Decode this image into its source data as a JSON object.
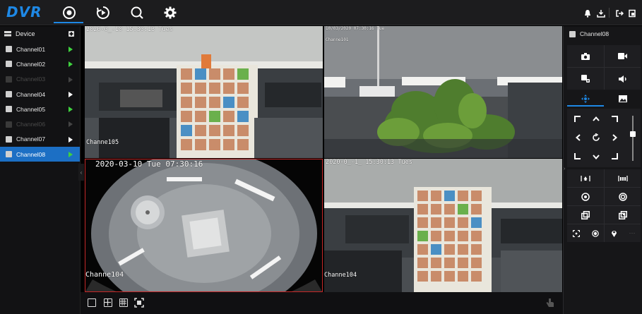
{
  "app": {
    "logo": "DVR",
    "accent": "#1e88e5"
  },
  "topnav": [
    "live-view-icon",
    "playback-icon",
    "search-icon",
    "settings-icon"
  ],
  "topright": [
    "bell-icon",
    "user-icon",
    "logout-icon",
    "exit-icon"
  ],
  "device_panel": {
    "title": "Device",
    "channels": [
      {
        "label": "Channel01",
        "state": "active"
      },
      {
        "label": "Channel02",
        "state": "active"
      },
      {
        "label": "Channel03",
        "state": "disabled"
      },
      {
        "label": "Channel04",
        "state": "online"
      },
      {
        "label": "Channel05",
        "state": "active"
      },
      {
        "label": "Channel06",
        "state": "disabled"
      },
      {
        "label": "Channel07",
        "state": "online"
      },
      {
        "label": "Channel08",
        "state": "selected"
      }
    ]
  },
  "video": {
    "tiles": [
      {
        "timestamp": "2020-0_-10 15:30:13 Tues",
        "channel_name": "Channe105"
      },
      {
        "timestamp": "10/03/2020 07:30:16 Tue",
        "channel_name": "Channe101"
      },
      {
        "timestamp": "2020-03-10 Tue 07:30:16",
        "channel_name": "Channe104"
      },
      {
        "timestamp": "2020-0_-1_ 15:30:13 Tues",
        "channel_name": "Channe104"
      }
    ]
  },
  "layout_buttons": [
    "layout-1-icon",
    "layout-4-icon",
    "layout-9-icon",
    "fullscreen-icon"
  ],
  "ptz_panel": {
    "title": "Channel08",
    "buttons": [
      "snapshot-icon",
      "record-icon",
      "talk-icon",
      "audio-icon",
      "ptz-icon",
      "image-icon"
    ]
  }
}
